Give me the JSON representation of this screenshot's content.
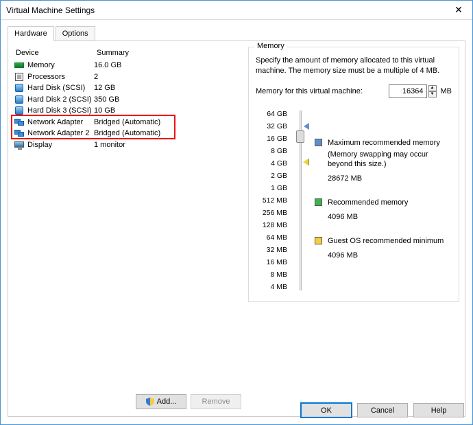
{
  "window": {
    "title": "Virtual Machine Settings"
  },
  "tabs": {
    "hardware": "Hardware",
    "options": "Options"
  },
  "table": {
    "headers": {
      "device": "Device",
      "summary": "Summary"
    },
    "rows": [
      {
        "icon": "memory-icon",
        "device": "Memory",
        "summary": "16.0 GB"
      },
      {
        "icon": "cpu-icon",
        "device": "Processors",
        "summary": "2"
      },
      {
        "icon": "disk-icon",
        "device": "Hard Disk (SCSI)",
        "summary": "12 GB"
      },
      {
        "icon": "disk-icon",
        "device": "Hard Disk 2 (SCSI)",
        "summary": "350 GB"
      },
      {
        "icon": "disk-icon",
        "device": "Hard Disk 3 (SCSI)",
        "summary": "10 GB"
      },
      {
        "icon": "network-icon",
        "device": "Network Adapter",
        "summary": "Bridged (Automatic)"
      },
      {
        "icon": "network-icon",
        "device": "Network Adapter 2",
        "summary": "Bridged (Automatic)"
      },
      {
        "icon": "display-icon",
        "device": "Display",
        "summary": "1 monitor"
      }
    ]
  },
  "buttons": {
    "add": "Add...",
    "remove": "Remove",
    "ok": "OK",
    "cancel": "Cancel",
    "help": "Help"
  },
  "memory": {
    "group_title": "Memory",
    "description": "Specify the amount of memory allocated to this virtual machine. The memory size must be a multiple of 4 MB.",
    "input_label": "Memory for this virtual machine:",
    "value": "16364",
    "unit": "MB",
    "ticks": [
      "64 GB",
      "32 GB",
      "16 GB",
      "8 GB",
      "4 GB",
      "2 GB",
      "1 GB",
      "512 MB",
      "256 MB",
      "128 MB",
      "64 MB",
      "32 MB",
      "16 MB",
      "8 MB",
      "4 MB"
    ],
    "legend": {
      "max": {
        "label": "Maximum recommended memory",
        "note": "(Memory swapping may occur beyond this size.)",
        "value": "28672 MB",
        "color": "#5f8fc9"
      },
      "rec": {
        "label": "Recommended memory",
        "value": "4096 MB",
        "color": "#39b54a"
      },
      "min": {
        "label": "Guest OS recommended minimum",
        "value": "4096 MB",
        "color": "#f6cf3a"
      }
    }
  }
}
